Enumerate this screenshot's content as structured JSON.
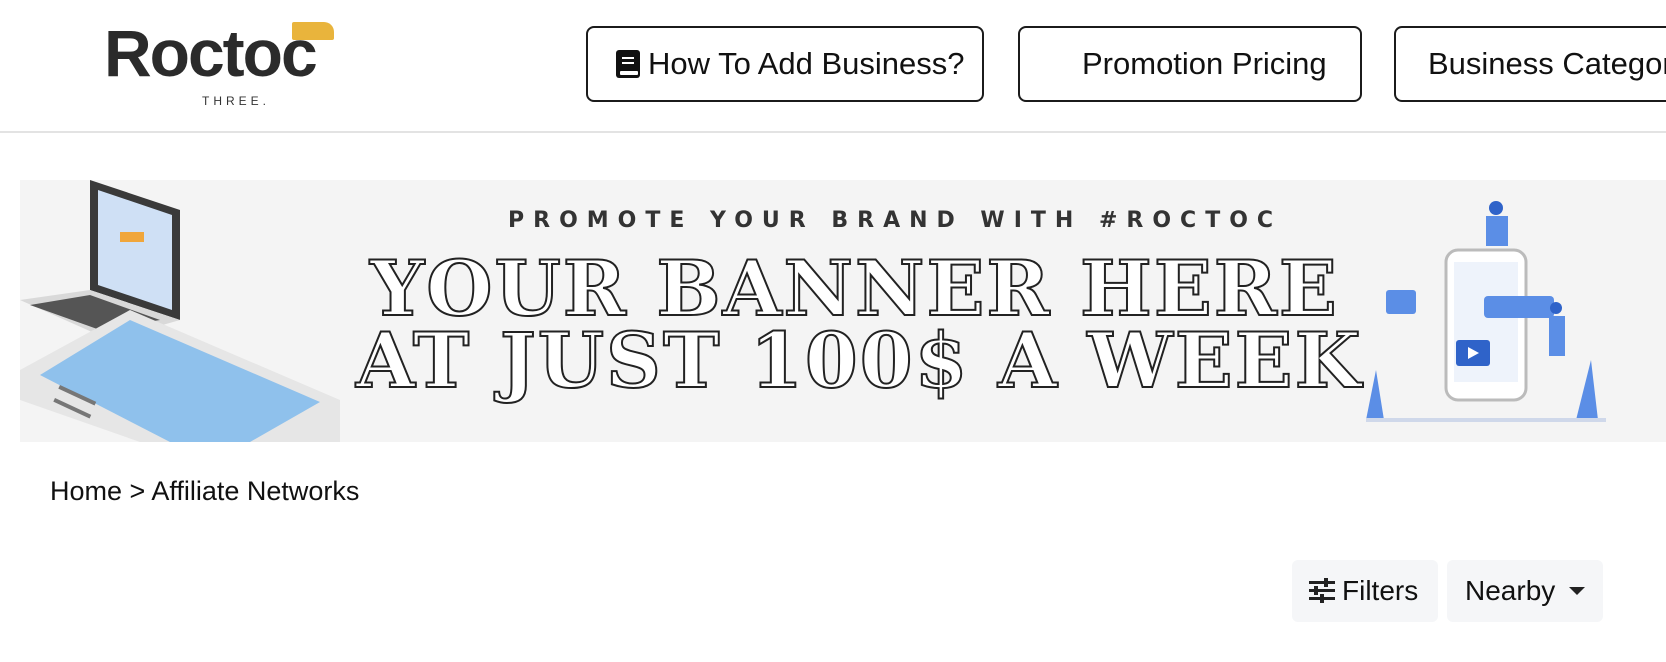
{
  "header": {
    "logo": {
      "word": "Roctoc",
      "sub": "THREE."
    },
    "nav": [
      {
        "label": "How To Add Business?",
        "icon": "book-icon"
      },
      {
        "label": "Promotion Pricing"
      },
      {
        "label": "Business Categor"
      }
    ]
  },
  "banner": {
    "kicker": "PROMOTE YOUR BRAND WITH #ROCTOC",
    "line1": "YOUR BANNER HERE",
    "line2": "AT JUST 100$ A WEEK"
  },
  "breadcrumb": {
    "home": "Home",
    "separator": ">",
    "current": "Affiliate Networks"
  },
  "controls": {
    "filters_label": "Filters",
    "filters_icon": "sliders-icon",
    "sort_label": "Nearby",
    "sort_icon": "caret-down-icon"
  },
  "colors": {
    "accent": "#e9b43c",
    "illustration_blue": "#5b8ee6",
    "border": "#1b1b1b",
    "control_bg": "#f5f6f8"
  }
}
